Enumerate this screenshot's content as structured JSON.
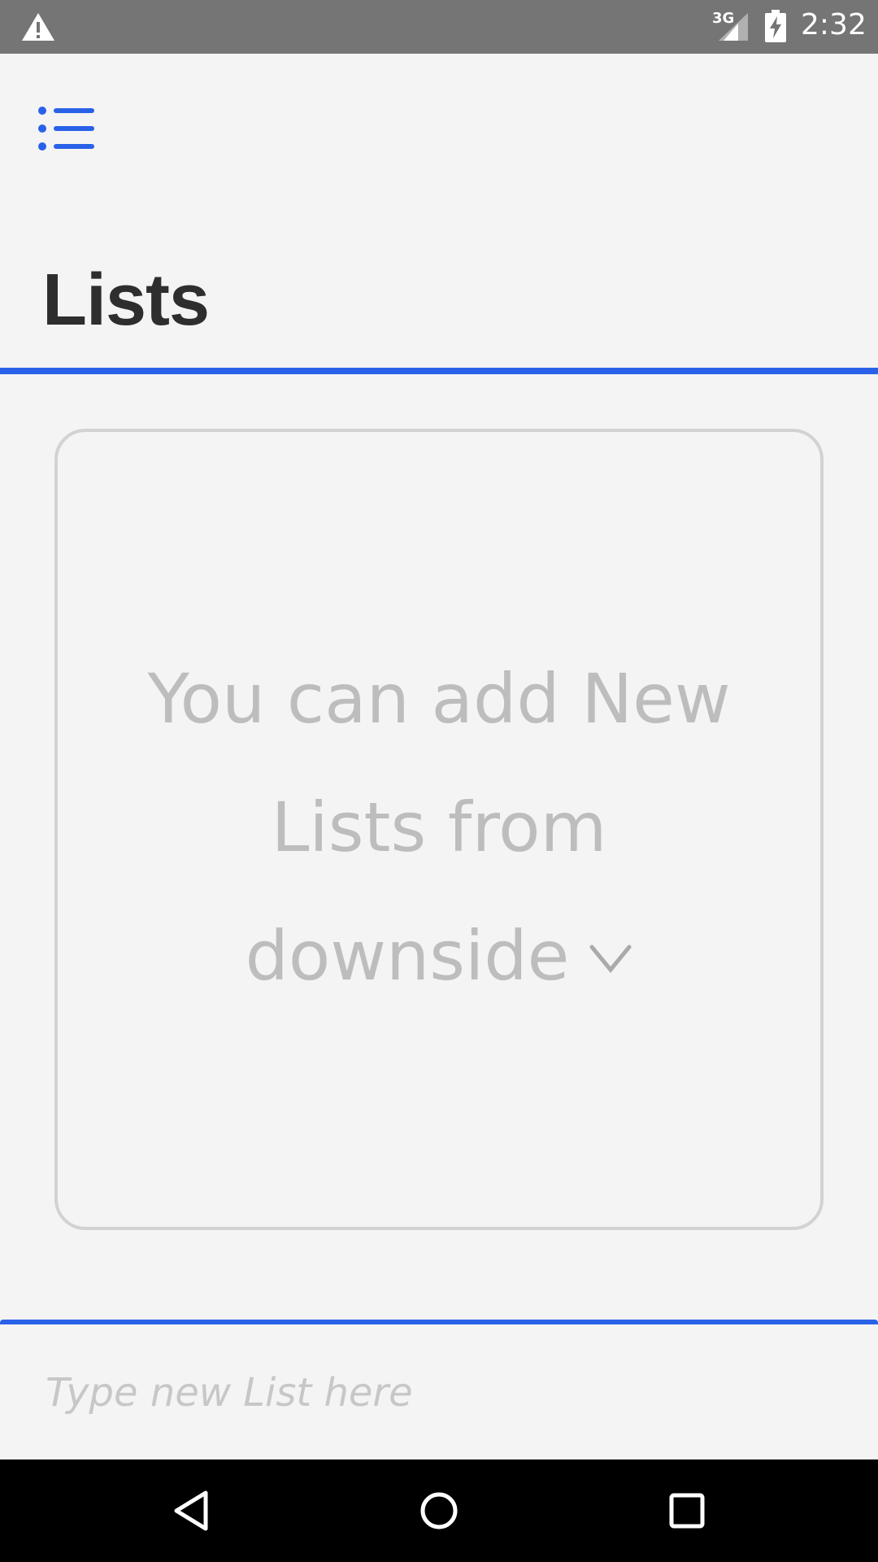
{
  "status_bar": {
    "network_label": "3G",
    "time": "2:32",
    "icons": [
      "warning-icon",
      "signal-icon",
      "battery-charging-icon"
    ]
  },
  "header": {
    "menu_icon": "list-menu-icon",
    "title": "Lists"
  },
  "empty_state": {
    "line1": "You can add New",
    "line2": "Lists from",
    "line3": "downside",
    "icon": "chevron-down-icon"
  },
  "new_list": {
    "placeholder": "Type new List here",
    "value": ""
  },
  "nav_bar": {
    "icons": [
      "back-icon",
      "home-icon",
      "recent-apps-icon"
    ]
  },
  "colors": {
    "accent": "#2962e8",
    "title": "#2e2e2e",
    "muted_text": "#bdbdbd",
    "background": "#f4f4f4",
    "status_bar": "#757575"
  }
}
